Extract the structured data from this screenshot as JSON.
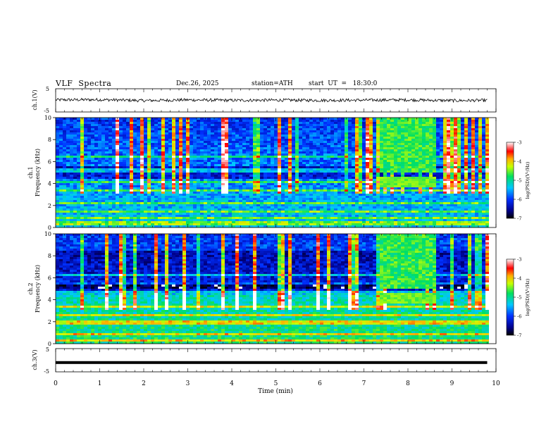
{
  "header": {
    "title": "VLF  Spectra",
    "date": "Dec.26, 2025",
    "station": "station=ATH",
    "start_ut": "start  UT  =   18:30:0"
  },
  "chart_data": [
    {
      "type": "line",
      "name": "ch1-waveform",
      "ylabel": "ch.1(V)",
      "ylim": [
        -5,
        5
      ],
      "yticks": [
        "5",
        "-5"
      ],
      "x": [
        0,
        1,
        2,
        3,
        4,
        5,
        6,
        7,
        8,
        9,
        9.8
      ],
      "y": [
        0.2,
        0.3,
        -0.1,
        0.2,
        0.0,
        0.1,
        0.0,
        0.1,
        0.2,
        -0.1,
        0.0
      ]
    },
    {
      "type": "heatmap",
      "name": "ch1-spectrogram",
      "ylabel_top": "ch.1",
      "ylabel_bottom": "Frequency (kHz)",
      "ylim": [
        0,
        10
      ],
      "yticks": [
        "10",
        "8",
        "6",
        "4",
        "2",
        "0"
      ],
      "colorbar": {
        "label": "log(PSD)(V²/Hz)",
        "ticks": [
          "-3",
          "-4",
          "-5",
          "-6",
          "-7"
        ],
        "range": [
          -7,
          -3
        ]
      },
      "features": {
        "broadband_burst_min": [
          7.4,
          8.65
        ],
        "narrowband_band_khz": [
          3.7,
          4.6
        ]
      }
    },
    {
      "type": "heatmap",
      "name": "ch2-spectrogram",
      "ylabel_top": "ch.2",
      "ylabel_bottom": "Frequency (kHz)",
      "ylim": [
        0,
        10
      ],
      "yticks": [
        "10",
        "8",
        "6",
        "4",
        "2",
        "0"
      ],
      "colorbar": {
        "label": "log(PSD)(V²/Hz)",
        "ticks": [
          "-3",
          "-4",
          "-5",
          "-6",
          "-7"
        ],
        "range": [
          -7,
          -3
        ]
      },
      "features": {
        "broadband_burst_min": [
          7.4,
          8.65
        ],
        "narrowband_band_khz": [
          3.7,
          4.6
        ]
      }
    },
    {
      "type": "line",
      "name": "ch3-waveform",
      "ylabel": "ch.3(V)",
      "ylim": [
        -5,
        5
      ],
      "yticks": [
        "5",
        "-5"
      ],
      "x": [
        0,
        9.8
      ],
      "y": [
        -1.0,
        -1.0
      ]
    }
  ],
  "xaxis": {
    "label": "Time  (min)",
    "ticks": [
      "0",
      "1",
      "2",
      "3",
      "4",
      "5",
      "6",
      "7",
      "8",
      "9",
      "10"
    ]
  }
}
